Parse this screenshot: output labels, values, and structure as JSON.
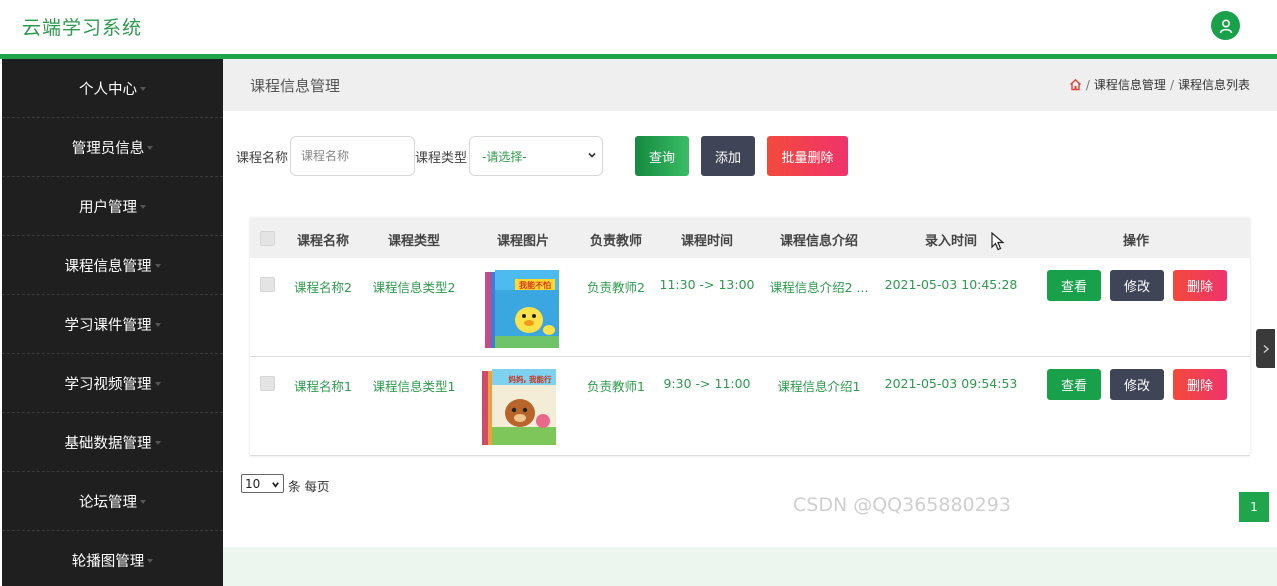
{
  "app": {
    "title": "云端学习系统"
  },
  "sidebar": {
    "items": [
      {
        "label": "个人中心"
      },
      {
        "label": "管理员信息"
      },
      {
        "label": "用户管理"
      },
      {
        "label": "课程信息管理"
      },
      {
        "label": "学习课件管理"
      },
      {
        "label": "学习视频管理"
      },
      {
        "label": "基础数据管理"
      },
      {
        "label": "论坛管理"
      },
      {
        "label": "轮播图管理"
      }
    ]
  },
  "header": {
    "page_title": "课程信息管理",
    "breadcrumb": {
      "sep": "/",
      "items": [
        "课程信息管理",
        "课程信息列表"
      ]
    }
  },
  "search": {
    "name_label": "课程名称",
    "name_placeholder": "课程名称",
    "type_label": "课程类型",
    "type_selected": "-请选择-",
    "query_label": "查询",
    "add_label": "添加",
    "batch_delete_label": "批量删除"
  },
  "table": {
    "headers": [
      "课程名称",
      "课程类型",
      "课程图片",
      "负责教师",
      "课程时间",
      "课程信息介绍",
      "录入时间",
      "操作"
    ],
    "rows": [
      {
        "name": "课程名称2",
        "type": "课程信息类型2",
        "cover_text": "我能不怕",
        "teacher": "负责教师2",
        "time": "11:30 -> 13:00",
        "intro": "课程信息介绍2 ...",
        "created": "2021-05-03 10:45:28",
        "view": "查看",
        "edit": "修改",
        "delete": "删除"
      },
      {
        "name": "课程名称1",
        "type": "课程信息类型1",
        "cover_text": "妈妈, 我能行",
        "teacher": "负责教师1",
        "time": "9:30 -> 11:00",
        "intro": "课程信息介绍1",
        "created": "2021-05-03 09:54:53",
        "view": "查看",
        "edit": "修改",
        "delete": "删除"
      }
    ]
  },
  "pagination": {
    "page_size": "10",
    "per_page_label": "条 每页",
    "current_page": "1"
  },
  "watermark": "CSDN @QQ365880293",
  "colors": {
    "accent": "#1fa54b",
    "text_green": "#2e9a4e",
    "sidebar_bg": "#1f1f1f",
    "btn_dark": "#3f4556",
    "btn_red": "#f04a45"
  },
  "icons": [
    "user-icon",
    "home-icon",
    "chevron-down-icon",
    "chevron-right-icon",
    "mouse-pointer-icon"
  ]
}
